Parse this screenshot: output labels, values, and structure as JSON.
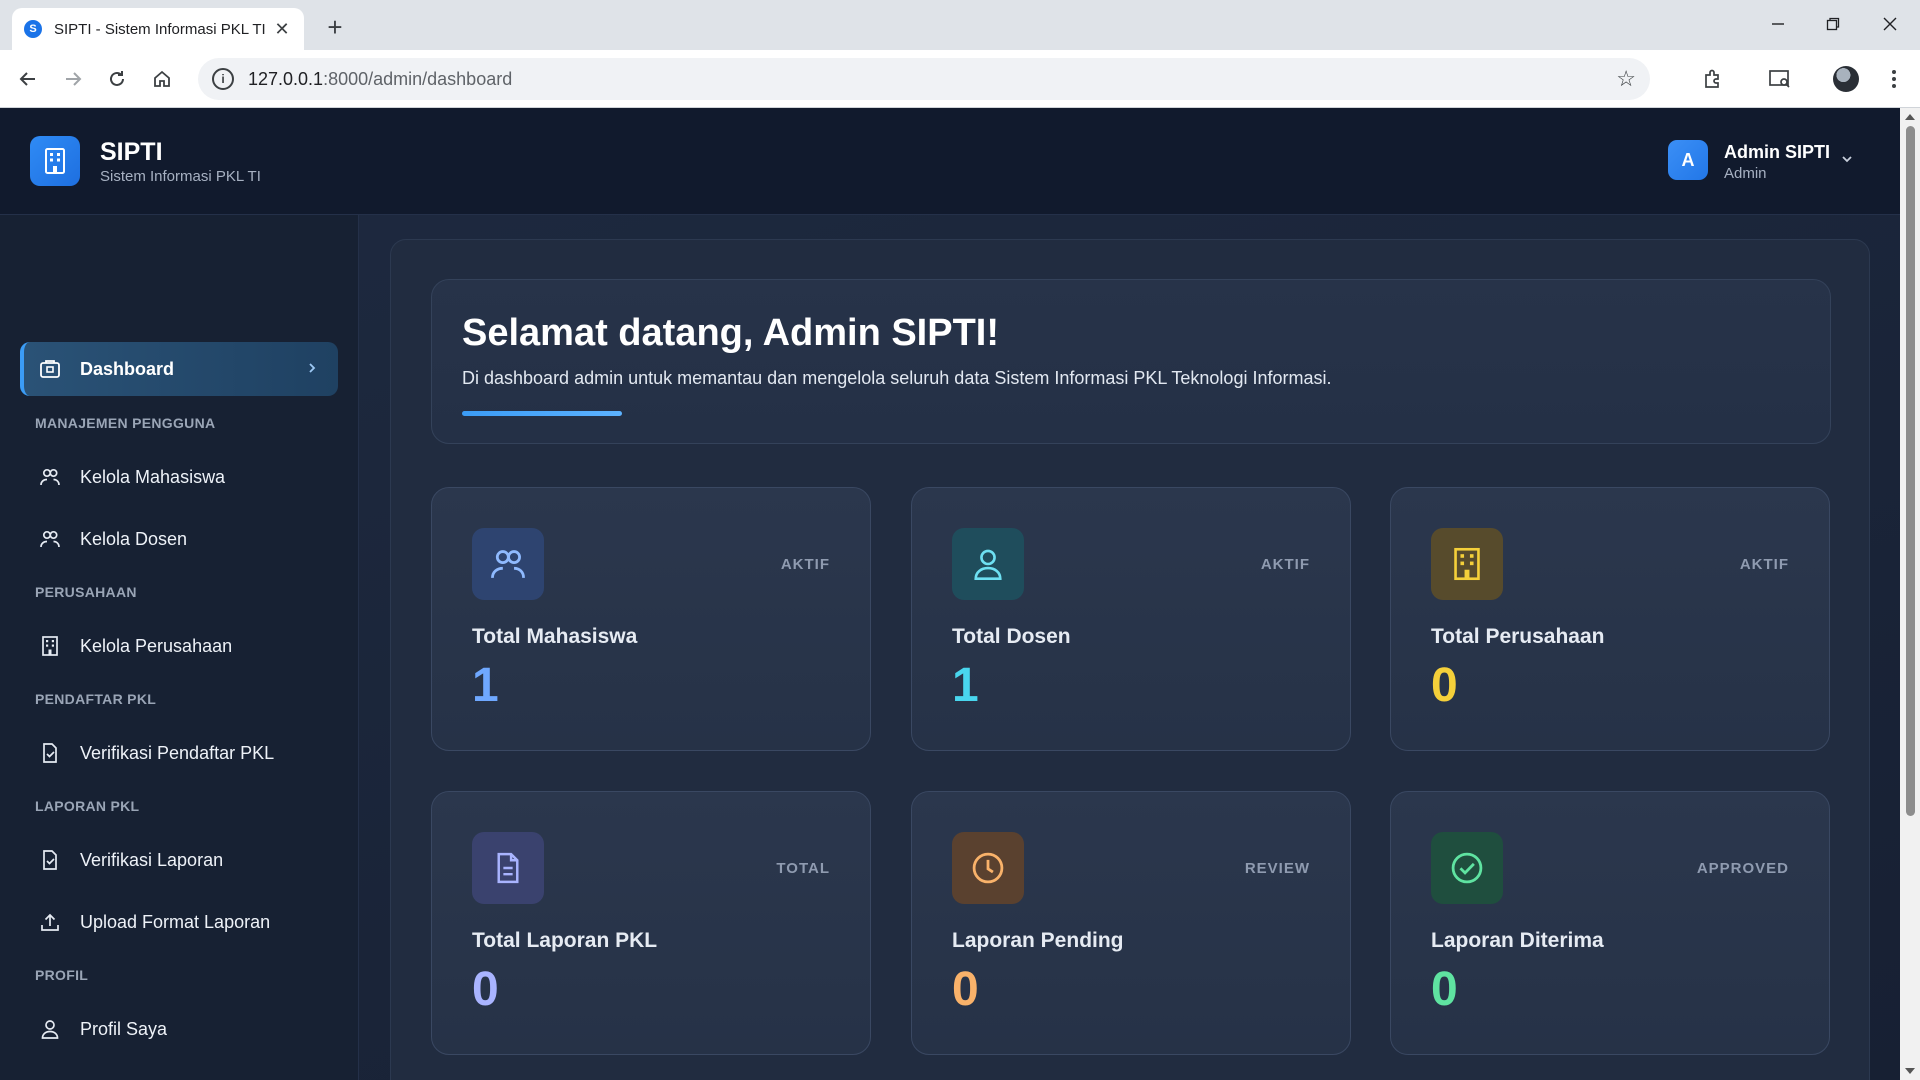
{
  "browser": {
    "tab_title": "SIPTI - Sistem Informasi PKL TI",
    "url_host": "127.0.0.1",
    "url_rest": ":8000/admin/dashboard"
  },
  "header": {
    "brand_name": "SIPTI",
    "brand_subtitle": "Sistem Informasi PKL TI",
    "user_initial": "A",
    "user_name": "Admin SIPTI",
    "user_role": "Admin"
  },
  "sidebar": {
    "dashboard": "Dashboard",
    "sections": {
      "users": "MANAJEMEN PENGGUNA",
      "company": "PERUSAHAAN",
      "registrant": "PENDAFTAR PKL",
      "report": "LAPORAN PKL",
      "profile": "PROFIL"
    },
    "items": {
      "mahasiswa": "Kelola Mahasiswa",
      "dosen": "Kelola Dosen",
      "perusahaan": "Kelola Perusahaan",
      "verifikasi_pendaftar": "Verifikasi Pendaftar PKL",
      "verifikasi_laporan": "Verifikasi Laporan",
      "upload_format": "Upload Format Laporan",
      "profil": "Profil Saya"
    }
  },
  "welcome": {
    "title": "Selamat datang, Admin SIPTI!",
    "text": "Di dashboard admin untuk memantau dan mengelola seluruh data Sistem Informasi PKL Teknologi Informasi."
  },
  "stats": [
    {
      "label": "Total Mahasiswa",
      "tag": "AKTIF",
      "value": "1",
      "icon": "users-icon",
      "color": "#6fa8ff",
      "icon_bg": "#2e4470"
    },
    {
      "label": "Total Dosen",
      "tag": "AKTIF",
      "value": "1",
      "icon": "user-icon",
      "color": "#49d6ee",
      "icon_bg": "#1f4d5c"
    },
    {
      "label": "Total Perusahaan",
      "tag": "AKTIF",
      "value": "0",
      "icon": "building-icon",
      "color": "#f5d03a",
      "icon_bg": "#574b2c"
    },
    {
      "label": "Total Laporan PKL",
      "tag": "TOTAL",
      "value": "0",
      "icon": "document-icon",
      "color": "#a9b4ff",
      "icon_bg": "#3a426e"
    },
    {
      "label": "Laporan Pending",
      "tag": "REVIEW",
      "value": "0",
      "icon": "clock-icon",
      "color": "#f9b26a",
      "icon_bg": "#5a412f"
    },
    {
      "label": "Laporan Diterima",
      "tag": "APPROVED",
      "value": "0",
      "icon": "check-circle-icon",
      "color": "#5fe3a1",
      "icon_bg": "#1f4e3e"
    }
  ]
}
